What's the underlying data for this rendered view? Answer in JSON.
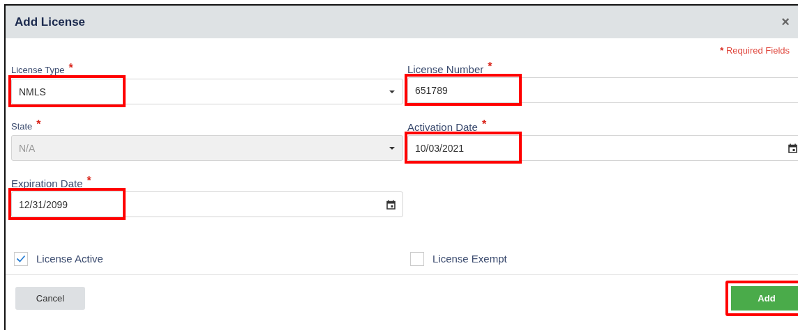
{
  "dialog": {
    "title": "Add License",
    "close": "×",
    "required_note": {
      "mark": "*",
      "text": "Required Fields"
    },
    "fields": [
      {
        "label": "License Type",
        "required_mark": "*",
        "kind": "select",
        "value": "NMLS",
        "disabled": false,
        "highlighted": true
      },
      {
        "label": "License Number",
        "required_mark": "*",
        "kind": "text",
        "value": "651789",
        "disabled": false,
        "highlighted": true
      },
      {
        "label": "State",
        "required_mark": "*",
        "kind": "select",
        "value": "N/A",
        "disabled": true,
        "highlighted": false
      },
      {
        "label": "Activation Date",
        "required_mark": "*",
        "kind": "date",
        "value": "10/03/2021",
        "disabled": false,
        "highlighted": true
      },
      {
        "label": "Expiration Date",
        "required_mark": "*",
        "kind": "date",
        "value": "12/31/2099",
        "disabled": false,
        "highlighted": true
      }
    ],
    "checkboxes": [
      {
        "label": "License Active",
        "checked": true
      },
      {
        "label": "License Exempt",
        "checked": false
      }
    ],
    "buttons": [
      {
        "label": "Cancel",
        "kind": "secondary",
        "highlighted": false
      },
      {
        "label": "Add",
        "kind": "primary",
        "highlighted": true
      }
    ]
  }
}
